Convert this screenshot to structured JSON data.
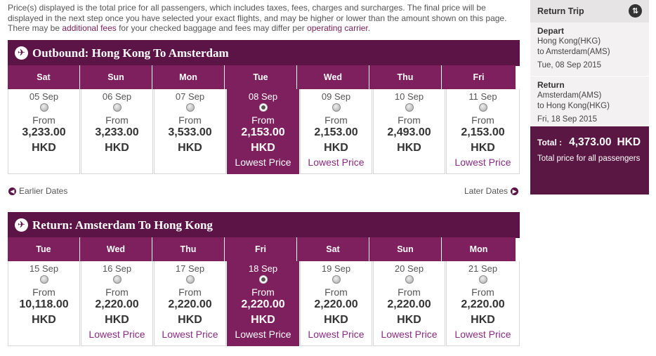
{
  "notice": {
    "part1": "Price(s) displayed is the total price for all passengers, which includes taxes, fees, charges and surcharges. The final price will be displayed in the next step once you have selected your exact flights, and may be higher or lower than the amount shown on this page. There may be ",
    "link1": "additional fees",
    "part2": " for your checked baggage and fees may differ per ",
    "link2": "operating carrier",
    "part3": "."
  },
  "outbound": {
    "title": "Outbound: Hong Kong To Amsterdam",
    "days": [
      {
        "dow": "Sat",
        "date": "05 Sep",
        "from": "From",
        "price": "3,233.00",
        "currency": "HKD",
        "badge": "",
        "selected": false
      },
      {
        "dow": "Sun",
        "date": "06 Sep",
        "from": "From",
        "price": "3,233.00",
        "currency": "HKD",
        "badge": "",
        "selected": false
      },
      {
        "dow": "Mon",
        "date": "07 Sep",
        "from": "From",
        "price": "3,533.00",
        "currency": "HKD",
        "badge": "",
        "selected": false
      },
      {
        "dow": "Tue",
        "date": "08 Sep",
        "from": "From",
        "price": "2,153.00",
        "currency": "HKD",
        "badge": "Lowest Price",
        "selected": true
      },
      {
        "dow": "Wed",
        "date": "09 Sep",
        "from": "From",
        "price": "2,153.00",
        "currency": "HKD",
        "badge": "Lowest Price",
        "selected": false
      },
      {
        "dow": "Thu",
        "date": "10 Sep",
        "from": "From",
        "price": "2,493.00",
        "currency": "HKD",
        "badge": "",
        "selected": false
      },
      {
        "dow": "Fri",
        "date": "11 Sep",
        "from": "From",
        "price": "2,153.00",
        "currency": "HKD",
        "badge": "Lowest Price",
        "selected": false
      }
    ],
    "earlier": "Earlier Dates",
    "later": "Later Dates"
  },
  "return": {
    "title": "Return: Amsterdam To Hong Kong",
    "days": [
      {
        "dow": "Tue",
        "date": "15 Sep",
        "from": "From",
        "price": "10,118.00",
        "currency": "HKD",
        "badge": "",
        "selected": false
      },
      {
        "dow": "Wed",
        "date": "16 Sep",
        "from": "From",
        "price": "2,220.00",
        "currency": "HKD",
        "badge": "Lowest Price",
        "selected": false
      },
      {
        "dow": "Thu",
        "date": "17 Sep",
        "from": "From",
        "price": "2,220.00",
        "currency": "HKD",
        "badge": "Lowest Price",
        "selected": false
      },
      {
        "dow": "Fri",
        "date": "18 Sep",
        "from": "From",
        "price": "2,220.00",
        "currency": "HKD",
        "badge": "Lowest Price",
        "selected": true
      },
      {
        "dow": "Sat",
        "date": "19 Sep",
        "from": "From",
        "price": "2,220.00",
        "currency": "HKD",
        "badge": "Lowest Price",
        "selected": false
      },
      {
        "dow": "Sun",
        "date": "20 Sep",
        "from": "From",
        "price": "2,220.00",
        "currency": "HKD",
        "badge": "Lowest Price",
        "selected": false
      },
      {
        "dow": "Mon",
        "date": "21 Sep",
        "from": "From",
        "price": "2,220.00",
        "currency": "HKD",
        "badge": "Lowest Price",
        "selected": false
      }
    ]
  },
  "summary": {
    "title": "Return Trip",
    "depart": {
      "label": "Depart",
      "from": "Hong Kong(HKG)",
      "to": "to Amsterdam(AMS)",
      "date": "Tue, 08 Sep 2015"
    },
    "ret": {
      "label": "Return",
      "from": "Amsterdam(AMS)",
      "to": "to Hong Kong(HKG)",
      "date": "Fri, 18 Sep 2015"
    },
    "total_label": "Total :",
    "total_amount": "4,373.00",
    "total_currency": "HKD",
    "total_desc": "Total price for all passengers"
  },
  "colors": {
    "brand": "#5c1447",
    "accent": "#7e1f5e",
    "link": "#8a2a82"
  },
  "icons": {
    "section": "airplane-icon",
    "nav_prev": "chevron-left-icon",
    "nav_next": "chevron-right-icon",
    "trip": "swap-icon"
  }
}
